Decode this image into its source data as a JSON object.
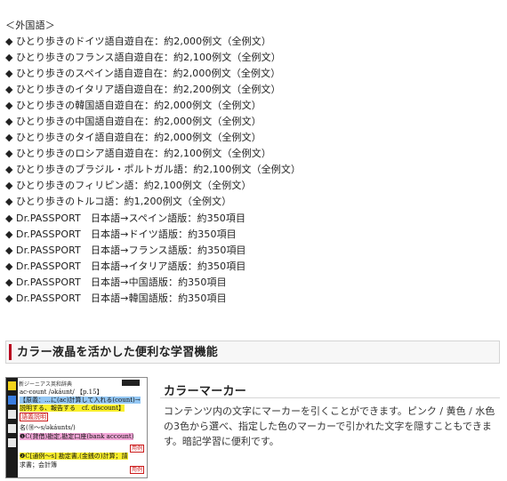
{
  "foreign_language": {
    "heading": "＜外国語＞",
    "items": [
      "ひとり歩きのドイツ語自遊自在：約2,000例文（全例文）",
      "ひとり歩きのフランス語自遊自在：約2,100例文（全例文）",
      "ひとり歩きのスペイン語自遊自在：約2,000例文（全例文）",
      "ひとり歩きのイタリア語自遊自在：約2,200例文（全例文）",
      "ひとり歩きの韓国語自遊自在：約2,000例文（全例文）",
      "ひとり歩きの中国語自遊自在：約2,000例文（全例文）",
      "ひとり歩きのタイ語自遊自在：約2,000例文（全例文）",
      "ひとり歩きのロシア語自遊自在：約2,100例文（全例文）",
      "ひとり歩きのブラジル・ポルトガル語：約2,100例文（全例文）",
      "ひとり歩きのフィリピン語：約2,100例文（全例文）",
      "ひとり歩きのトルコ語：約1,200例文（全例文）",
      "Dr.PASSPORT　日本語→スペイン語版：約350項目",
      "Dr.PASSPORT　日本語→ドイツ語版：約350項目",
      "Dr.PASSPORT　日本語→フランス語版：約350項目",
      "Dr.PASSPORT　日本語→イタリア語版：約350項目",
      "Dr.PASSPORT　日本語→中国語版：約350項目",
      "Dr.PASSPORT　日本語→韓国語版：約350項目"
    ],
    "bullet": "◆"
  },
  "section": {
    "title": "カラー液晶を活かした便利な学習機能",
    "accent_color": "#b8001e"
  },
  "feature": {
    "title": "カラーマーカー",
    "description": "コンテンツ内の文字にマーカーを引くことができます。ピンク / 黄色 / 水色の3色から選べ、指定した色のマーカーで引かれた文字を隠すこともできます。暗記学習に便利です。"
  },
  "thumbnail": {
    "head": "新ジーニアス英和辞典",
    "lines": [
      "ac-count /əkáunt/ 【p.15】",
      "【原義：…に(ac)計算して入れる(count)→",
      "説明する、報告する　cf. discount】",
      "語義説明",
      "名(⑩～s/əkáunts/)",
      "❶C(貸借)勘定,勘定口座(bank account)",
      "❷C[通例～s] 勘定書,(金銭の)計算；請",
      "求書；会計簿"
    ],
    "tags": [
      "用例",
      "用例"
    ]
  }
}
